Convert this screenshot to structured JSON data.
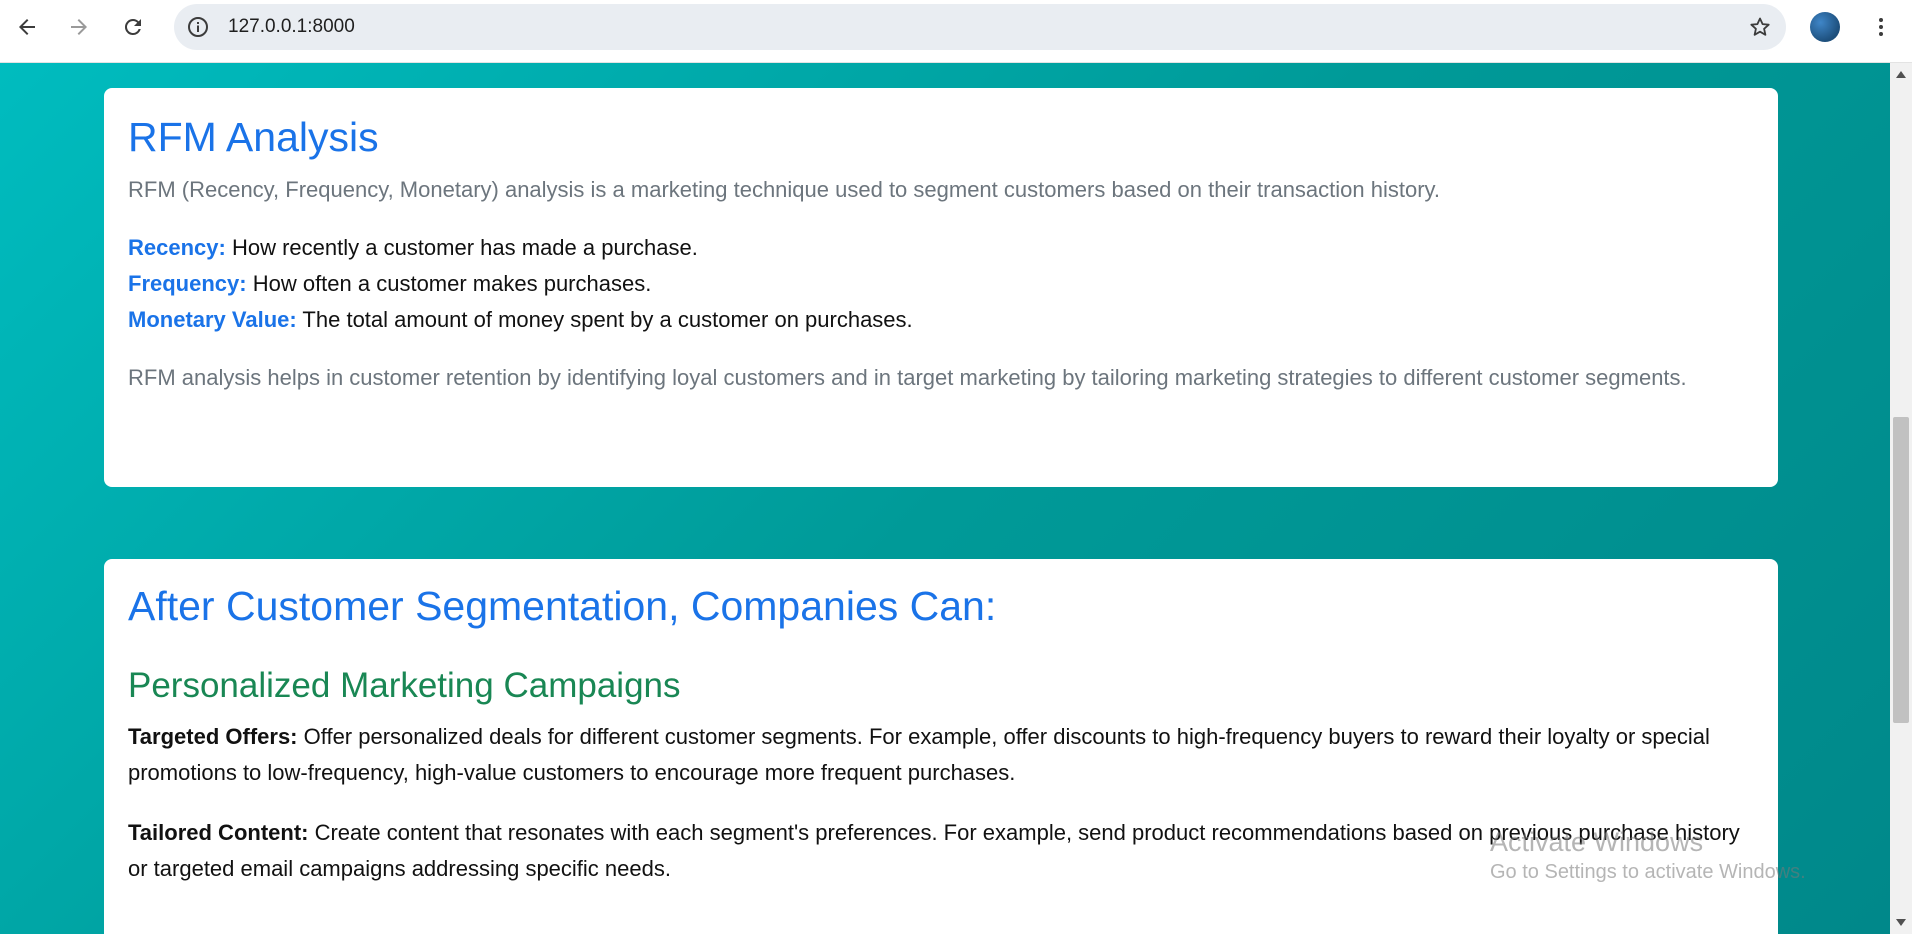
{
  "browser": {
    "url": "127.0.0.1:8000",
    "icons": [
      "back-arrow-icon",
      "forward-arrow-icon",
      "reload-icon",
      "site-info-icon",
      "bookmark-star-icon",
      "profile-avatar",
      "more-menu-icon"
    ]
  },
  "rfm_card": {
    "title": "RFM Analysis",
    "intro": "RFM (Recency, Frequency, Monetary) analysis is a marketing technique used to segment customers based on their transaction history.",
    "definitions": [
      {
        "term": "Recency:",
        "text": " How recently a customer has made a purchase."
      },
      {
        "term": "Frequency:",
        "text": " How often a customer makes purchases."
      },
      {
        "term": "Monetary Value:",
        "text": " The total amount of money spent by a customer on purchases."
      }
    ],
    "outro": "RFM analysis helps in customer retention by identifying loyal customers and in target marketing by tailoring marketing strategies to different customer segments."
  },
  "segmentation_card": {
    "title": "After Customer Segmentation, Companies Can:",
    "subtitle": "Personalized Marketing Campaigns",
    "items": [
      {
        "term": "Targeted Offers:",
        "text": " Offer personalized deals for different customer segments. For example, offer discounts to high-frequency buyers to reward their loyalty or special promotions to low-frequency, high-value customers to encourage more frequent purchases."
      },
      {
        "term": "Tailored Content:",
        "text": " Create content that resonates with each segment's preferences. For example, send product recommendations based on previous purchase history or targeted email campaigns addressing specific needs."
      }
    ]
  },
  "watermark": {
    "line1": "Activate Windows",
    "line2": "Go to Settings to activate Windows."
  },
  "colors": {
    "accent_blue": "#1a73e8",
    "accent_green": "#198754",
    "muted_text": "#6c757d",
    "background_teal": "#00a5a6"
  }
}
